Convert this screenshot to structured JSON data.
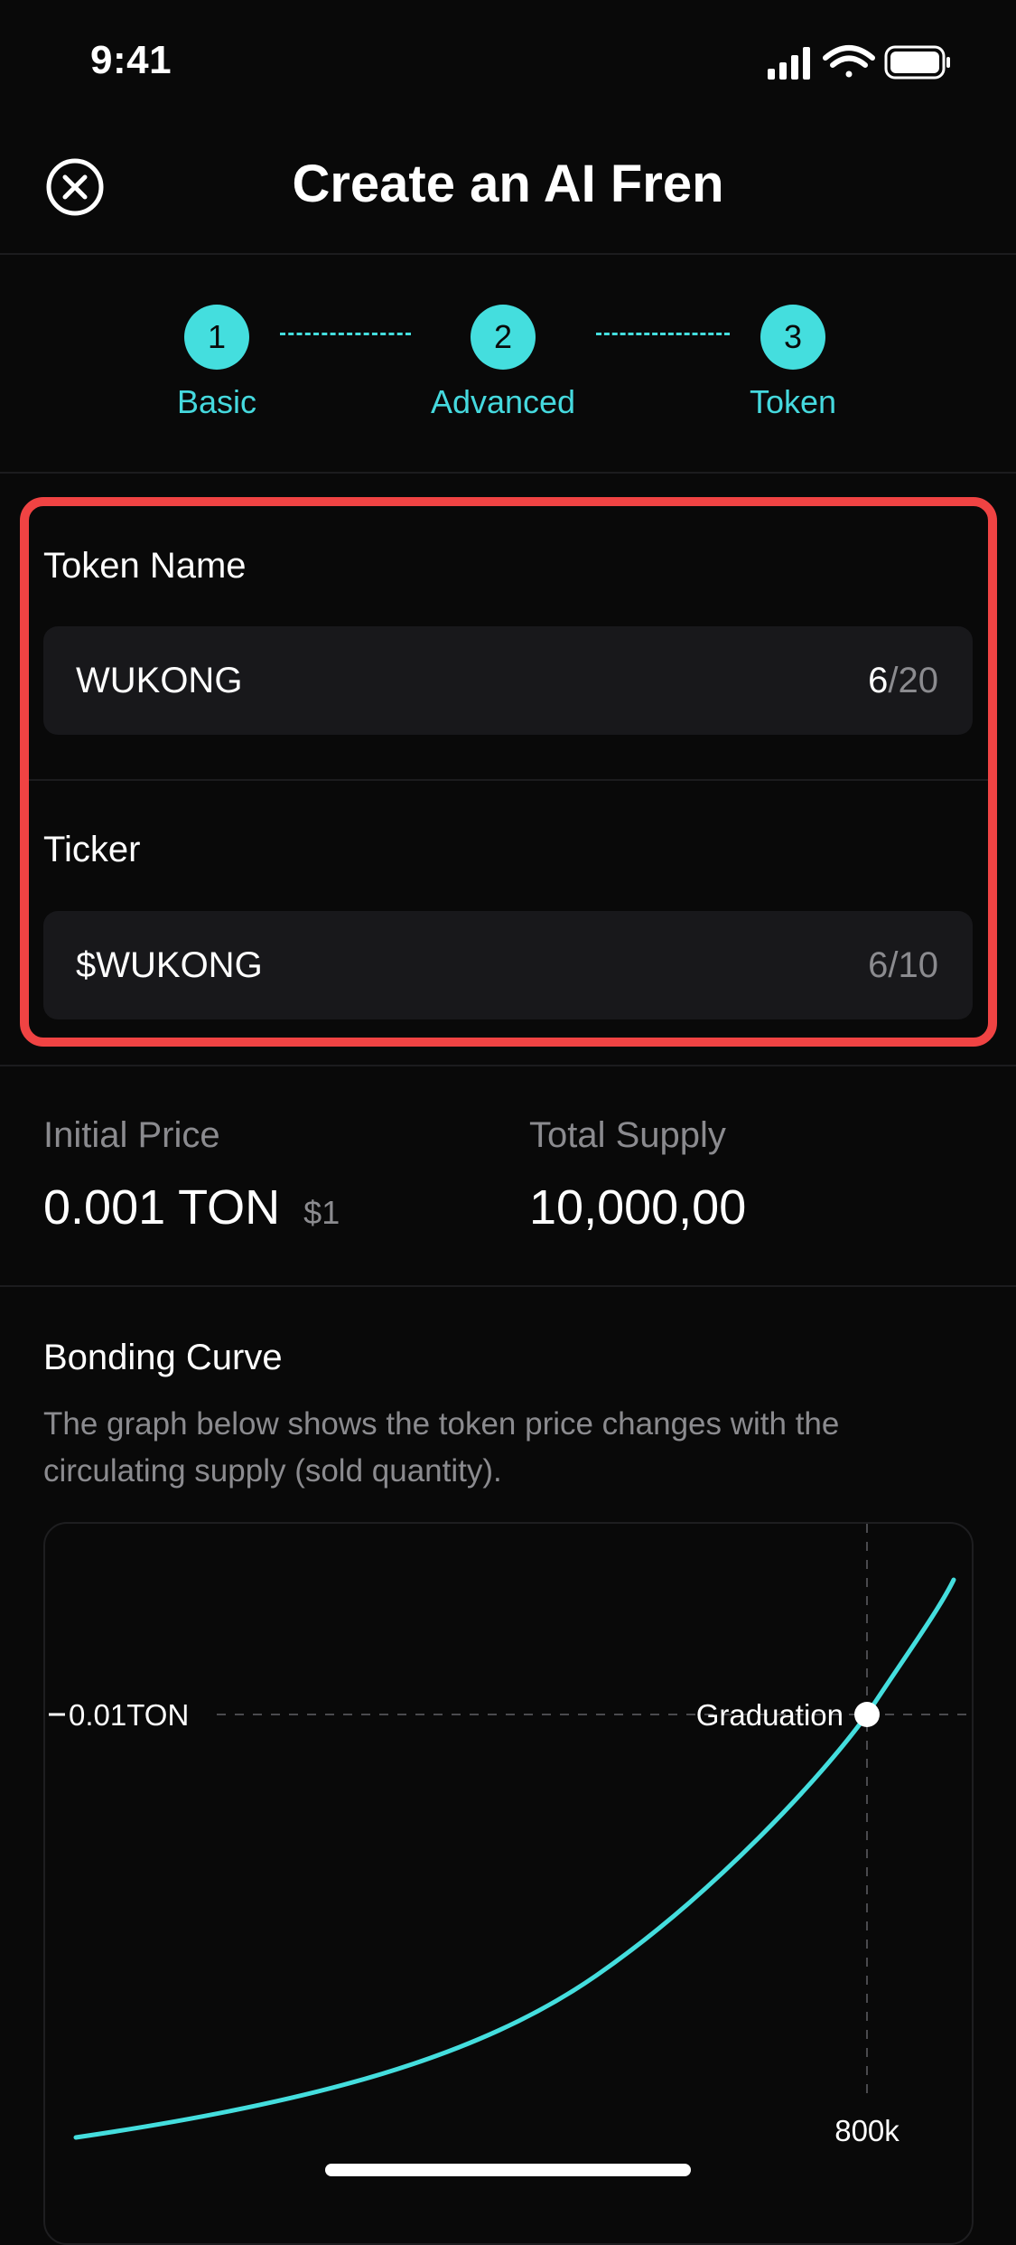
{
  "status_bar": {
    "time": "9:41"
  },
  "header": {
    "title": "Create an AI Fren"
  },
  "stepper": {
    "steps": [
      {
        "number": "1",
        "label": "Basic"
      },
      {
        "number": "2",
        "label": "Advanced"
      },
      {
        "number": "3",
        "label": "Token"
      }
    ]
  },
  "token_name": {
    "label": "Token Name",
    "value": "WUKONG",
    "count": "6",
    "max": "/20"
  },
  "ticker": {
    "label": "Ticker",
    "value": "$WUKONG",
    "count": "6",
    "max": "/10"
  },
  "stats": {
    "initial_price_label": "Initial Price",
    "initial_price_value": "0.001 TON",
    "initial_price_usd": "$1",
    "total_supply_label": "Total Supply",
    "total_supply_value": "10,000,00"
  },
  "bonding_curve": {
    "title": "Bonding Curve",
    "description": "The graph below shows the token price changes with the circulating supply (sold quantity)."
  },
  "chart_data": {
    "type": "line",
    "y_marker_label": "0.01TON",
    "point_label": "Graduation",
    "x_marker_label": "800k",
    "series_color": "#44dede"
  },
  "colors": {
    "accent": "#44dede",
    "highlight": "#f04343",
    "background": "#090909"
  }
}
